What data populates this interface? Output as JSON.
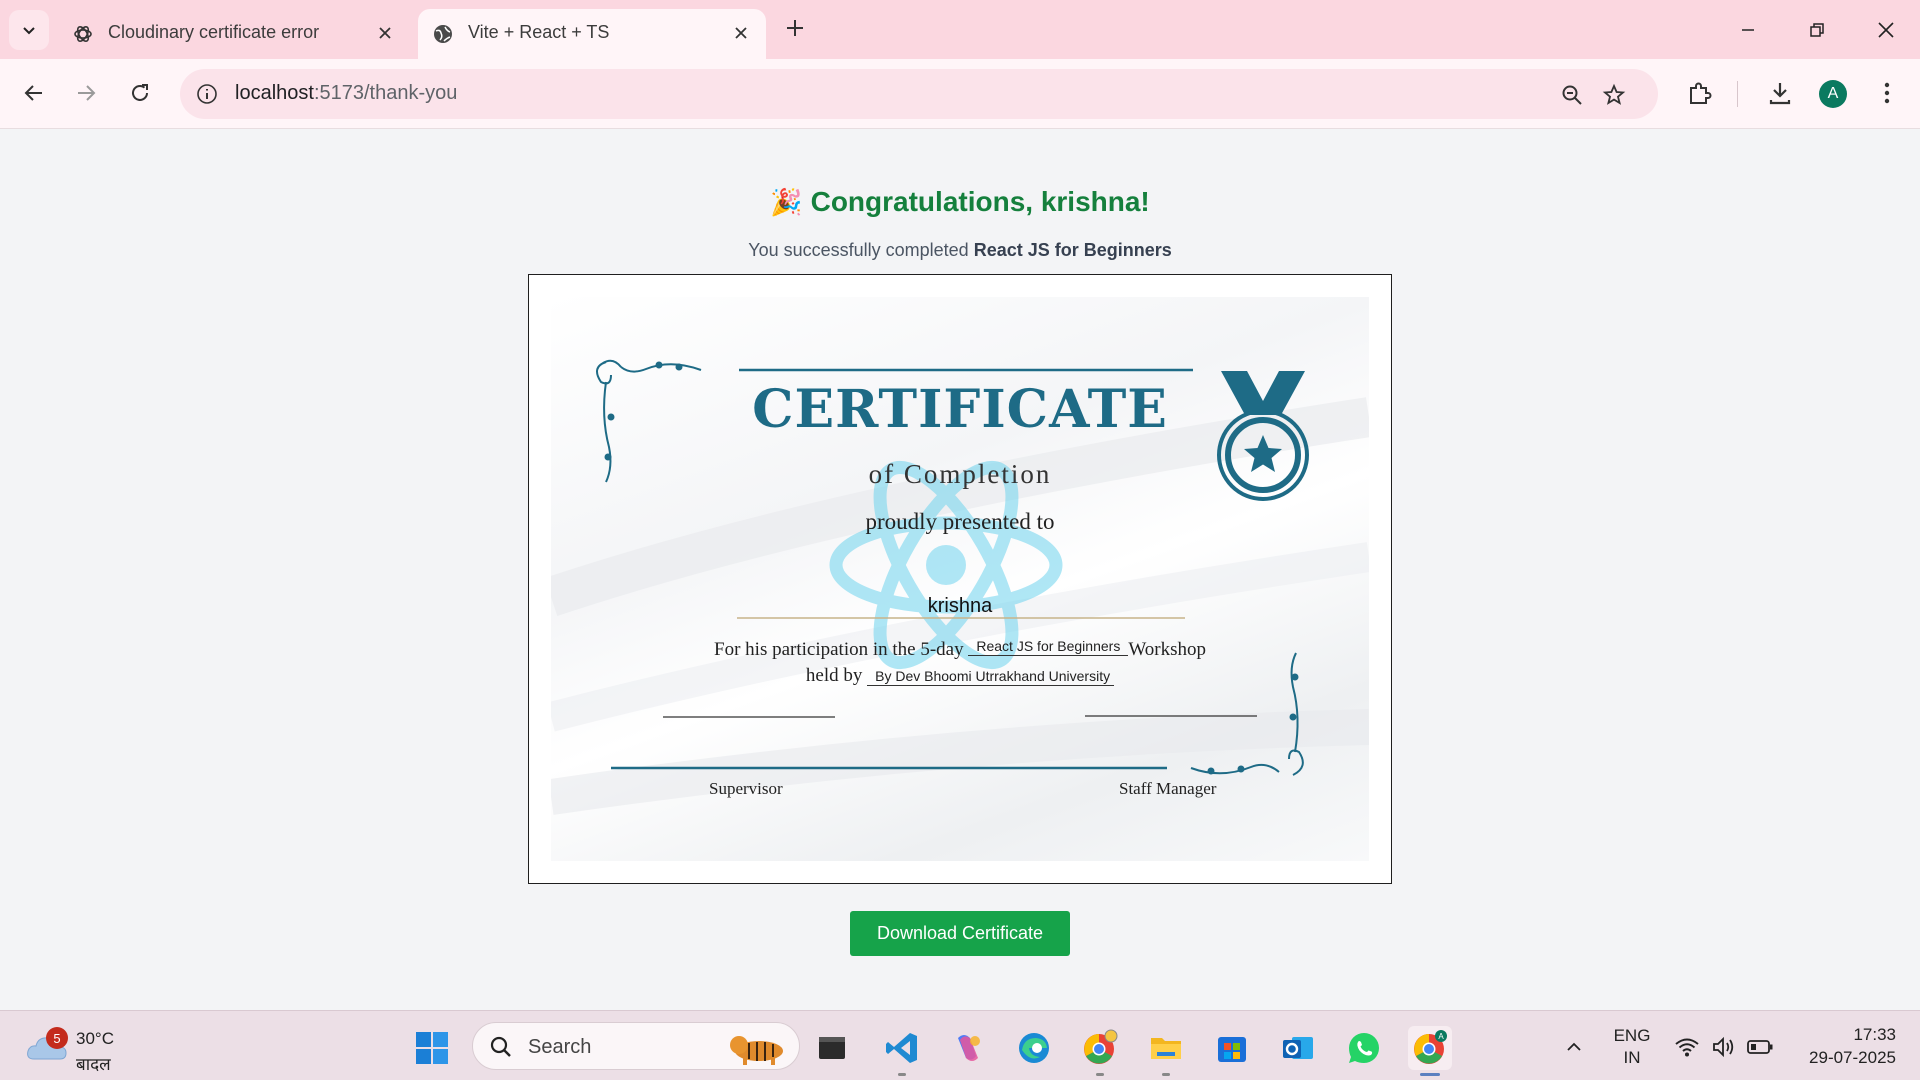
{
  "browser": {
    "tabs": [
      {
        "title": "Cloudinary certificate error",
        "active": false
      },
      {
        "title": "Vite + React + TS",
        "active": true
      }
    ],
    "address": {
      "host": "localhost",
      "path": ":5173/thank-you"
    }
  },
  "page": {
    "emoji": "🎉",
    "heading": "Congratulations, krishna!",
    "subtitle_prefix": "You successfully completed ",
    "course_name": "React JS for Beginners",
    "download_label": "Download Certificate"
  },
  "certificate": {
    "title": "CERTIFICATE",
    "subtitle": "of Completion",
    "presented": "proudly presented to",
    "recipient": "krishna",
    "participation_prefix": "For his participation in the 5-day",
    "workshop_name": "React JS for Beginners",
    "participation_suffix": "Workshop",
    "held_by_prefix": "held by",
    "organizer": "By Dev Bhoomi Utrrakhand University",
    "signature_left": "Supervisor",
    "signature_right": "Staff Manager",
    "colors": {
      "accent": "#1e6b86",
      "react_logo": "#61dafb"
    }
  },
  "taskbar": {
    "weather": {
      "temp": "30°C",
      "desc": "बादल",
      "badge": "5"
    },
    "search_label": "Search",
    "language": {
      "line1": "ENG",
      "line2": "IN"
    },
    "time": "17:33",
    "date": "29-07-2025",
    "apps": [
      "windows-start",
      "search",
      "file-explorer-dark",
      "vscode",
      "copilot",
      "edge",
      "chrome-beta",
      "file-explorer",
      "microsoft-store",
      "outlook",
      "whatsapp",
      "chrome"
    ]
  }
}
